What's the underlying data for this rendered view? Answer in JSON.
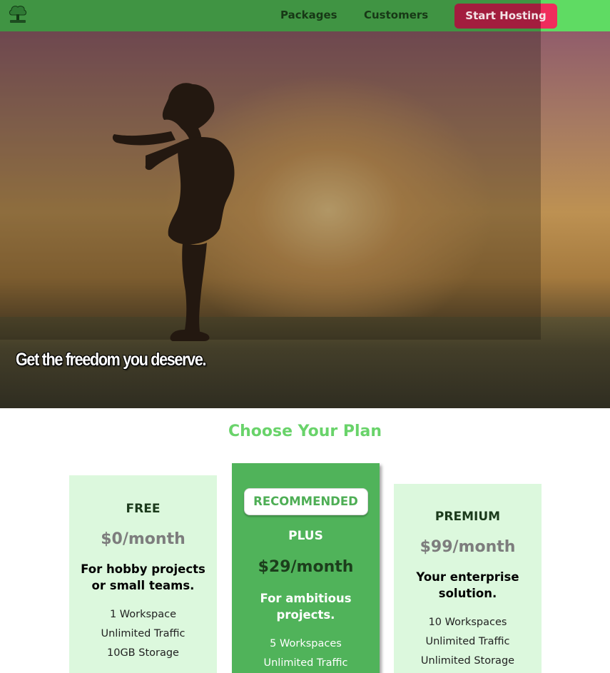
{
  "nav": {
    "logo_icon": "tree-cloud-logo-icon",
    "links": [
      {
        "label": "Packages"
      },
      {
        "label": "Customers"
      }
    ],
    "cta_label": "Start Hosting",
    "background": "#5fdb63",
    "cta_color": "#f02c5c"
  },
  "hero": {
    "tagline": "Get the freedom you deserve."
  },
  "plans_section": {
    "title": "Choose Your Plan",
    "plans": [
      {
        "name": "FREE",
        "price": "$0/month",
        "description": "For hobby projects or small teams.",
        "features": [
          "1 Workspace",
          "Unlimited Traffic",
          "10GB Storage"
        ]
      },
      {
        "badge": "RECOMMENDED",
        "name": "PLUS",
        "price": "$29/month",
        "description": "For ambitious projects.",
        "features": [
          "5 Workspaces",
          "Unlimited Traffic"
        ]
      },
      {
        "name": "PREMIUM",
        "price": "$99/month",
        "description": "Your enterprise solution.",
        "features": [
          "10 Workspaces",
          "Unlimited Traffic",
          "Unlimited Storage"
        ]
      }
    ]
  },
  "colors": {
    "accent_green": "#69d36a",
    "card_light": "#dcf8dd",
    "card_highlight": "#50b35a"
  }
}
